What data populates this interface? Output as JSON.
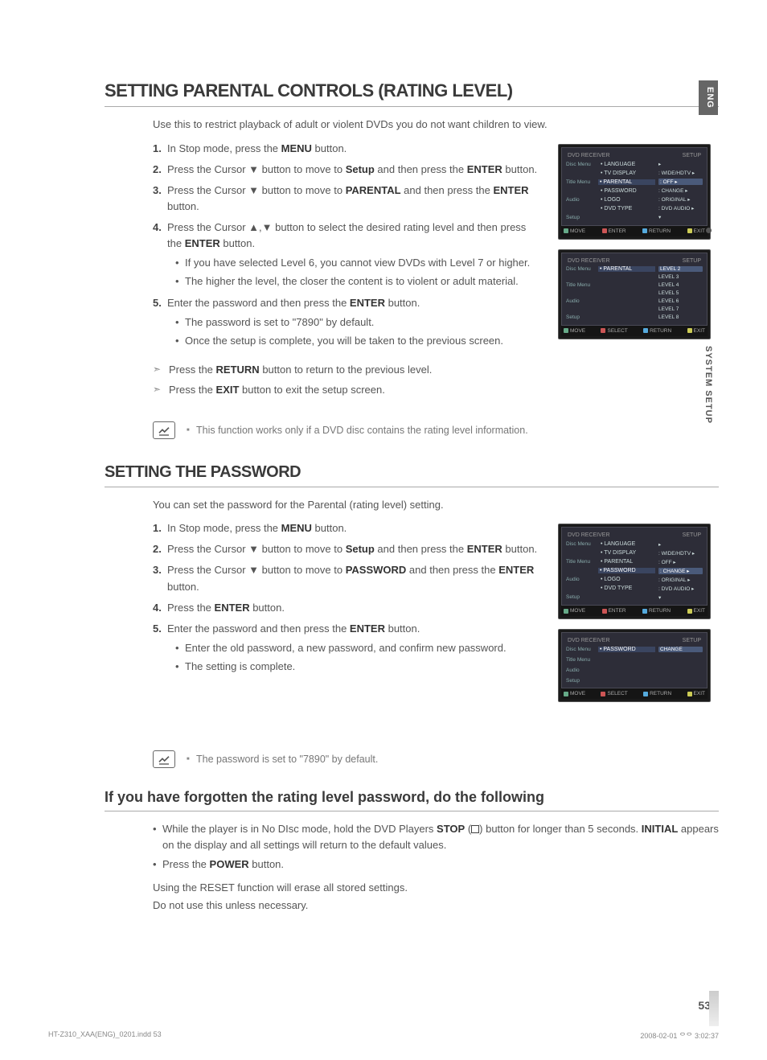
{
  "side": {
    "lang": "ENG",
    "section": "SYSTEM SETUP"
  },
  "pagenum": "53",
  "footer": {
    "left": "HT-Z310_XAA(ENG)_0201.indd   53",
    "right": "2008-02-01   ᄋᄋ 3:02:37"
  },
  "parental": {
    "heading": "SETTING PARENTAL CONTROLS (RATING LEVEL)",
    "intro": "Use this to restrict playback of adult or violent DVDs you do not want children to view.",
    "steps": [
      {
        "n": "1.",
        "pre": "In Stop mode, press the ",
        "b": "MENU",
        "post": " button."
      },
      {
        "n": "2.",
        "pre": "Press the Cursor ▼ button to move to ",
        "b": "Setup",
        "post": " and then press the ",
        "b2": "ENTER",
        "post2": " button."
      },
      {
        "n": "3.",
        "pre": "Press the Cursor ▼ button to move to ",
        "b": "PARENTAL",
        "post": " and then press the ",
        "b2": "ENTER",
        "post2": " button."
      },
      {
        "n": "4.",
        "pre": "Press the Cursor ▲,▼ button to select the desired rating level and then press the ",
        "b": "ENTER",
        "post": " button.",
        "subs": [
          "If you have selected Level 6, you cannot view DVDs with Level 7 or higher.",
          "The higher the level, the closer the content is to violent or adult material."
        ]
      },
      {
        "n": "5.",
        "pre": "Enter the password and then press the ",
        "b": "ENTER",
        "post": " button.",
        "subs": [
          "The password is set to \"7890\" by default.",
          "Once the setup is complete, you will be taken to the previous screen."
        ]
      }
    ],
    "arrows": [
      {
        "pre": "Press the ",
        "b": "RETURN",
        "post": " button to return to the previous level."
      },
      {
        "pre": "Press the ",
        "b": "EXIT",
        "post": " button to exit the setup screen."
      }
    ],
    "note": "This function works only if a DVD disc contains the rating level information."
  },
  "password": {
    "heading": "SETTING THE PASSWORD",
    "intro": "You can set the password for the Parental (rating level) setting.",
    "steps": [
      {
        "n": "1.",
        "pre": "In Stop mode, press the ",
        "b": "MENU",
        "post": " button."
      },
      {
        "n": "2.",
        "pre": "Press the Cursor ▼ button to move to ",
        "b": "Setup",
        "post": " and then press the ",
        "b2": "ENTER",
        "post2": " button."
      },
      {
        "n": "3.",
        "pre": "Press the Cursor ▼ button to move to ",
        "b": "PASSWORD",
        "post": " and then press the ",
        "b2": "ENTER",
        "post2": " button."
      },
      {
        "n": "4.",
        "pre": "Press the ",
        "b": "ENTER",
        "post": " button."
      },
      {
        "n": "5.",
        "pre": "Enter the password and then press the ",
        "b": "ENTER",
        "post": " button.",
        "subs": [
          "Enter the old password, a new password, and confirm new password.",
          "The setting is complete."
        ]
      }
    ],
    "note": "The password is set to \"7890\" by default."
  },
  "forgot": {
    "heading": "If you have forgotten the rating level password, do the following",
    "bullets": [
      {
        "pre": "While the player is in No DIsc mode, hold the DVD Players ",
        "b": "STOP",
        "mid": " (",
        "iconAfter": ") button for longer than 5 seconds. ",
        "b2": "INITIAL",
        "post2": " appears on the display and all settings will return to the default values."
      },
      {
        "pre": "Press the ",
        "b": "POWER",
        "post": " button."
      }
    ],
    "plain1": "Using the RESET function will erase all stored settings.",
    "plain2": "Do not use this unless necessary."
  },
  "osd": {
    "brand": "DVD RECEIVER",
    "setup": "SETUP",
    "rows1": [
      {
        "side": "Disc Menu",
        "label": "• LANGUAGE",
        "val": "",
        "arrow": "▸"
      },
      {
        "side": "",
        "label": "• TV DISPLAY",
        "val": ": WIDE/HDTV",
        "arrow": "▸"
      },
      {
        "side": "Title Menu",
        "label": "• PARENTAL",
        "val": ": OFF",
        "arrow": "▸",
        "hl": true
      },
      {
        "side": "",
        "label": "• PASSWORD",
        "val": ": CHANGE",
        "arrow": "▸"
      },
      {
        "side": "Audio",
        "label": "• LOGO",
        "val": ": ORIGINAL",
        "arrow": "▸"
      },
      {
        "side": "",
        "label": "• DVD TYPE",
        "val": ": DVD AUDIO",
        "arrow": "▸"
      },
      {
        "side": "Setup",
        "label": "",
        "val": "▾"
      }
    ],
    "rows2": [
      {
        "side": "Disc Menu",
        "label": "• PARENTAL",
        "val": "LEVEL 2",
        "hl": true
      },
      {
        "side": "",
        "label": "",
        "val": "LEVEL 3"
      },
      {
        "side": "Title Menu",
        "label": "",
        "val": "LEVEL 4"
      },
      {
        "side": "",
        "label": "",
        "val": "LEVEL 5"
      },
      {
        "side": "Audio",
        "label": "",
        "val": "LEVEL 6"
      },
      {
        "side": "",
        "label": "",
        "val": "LEVEL 7"
      },
      {
        "side": "Setup",
        "label": "",
        "val": "LEVEL 8"
      }
    ],
    "rows3": [
      {
        "side": "Disc Menu",
        "label": "• LANGUAGE",
        "val": "",
        "arrow": "▸"
      },
      {
        "side": "",
        "label": "• TV DISPLAY",
        "val": ": WIDE/HDTV",
        "arrow": "▸"
      },
      {
        "side": "Title Menu",
        "label": "• PARENTAL",
        "val": ": OFF",
        "arrow": "▸"
      },
      {
        "side": "",
        "label": "• PASSWORD",
        "val": ": CHANGE",
        "arrow": "▸",
        "hl": true
      },
      {
        "side": "Audio",
        "label": "• LOGO",
        "val": ": ORIGINAL",
        "arrow": "▸"
      },
      {
        "side": "",
        "label": "• DVD TYPE",
        "val": ": DVD AUDIO",
        "arrow": "▸"
      },
      {
        "side": "Setup",
        "label": "",
        "val": "▾"
      }
    ],
    "rows4": [
      {
        "side": "Disc Menu",
        "label": "• PASSWORD",
        "val": "CHANGE",
        "hl": true
      },
      {
        "side": "",
        "label": "",
        "val": ""
      },
      {
        "side": "Title Menu",
        "label": "",
        "val": ""
      },
      {
        "side": "",
        "label": "",
        "val": ""
      },
      {
        "side": "Audio",
        "label": "",
        "val": ""
      },
      {
        "side": "",
        "label": "",
        "val": ""
      },
      {
        "side": "Setup",
        "label": "",
        "val": ""
      }
    ],
    "footer1": {
      "a": "MOVE",
      "b": "ENTER",
      "c": "RETURN",
      "d": "EXIT"
    },
    "footer2": {
      "a": "MOVE",
      "b": "SELECT",
      "c": "RETURN",
      "d": "EXIT"
    }
  }
}
